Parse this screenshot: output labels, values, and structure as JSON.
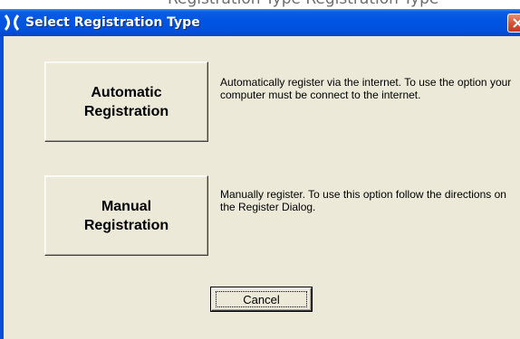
{
  "background_partial_text": "Registration Type Registration Type",
  "window": {
    "title": "Select Registration Type",
    "app_icon": "x-logo-icon",
    "close_icon": "close-icon"
  },
  "options": [
    {
      "button_line1": "Automatic",
      "button_line2": "Registration",
      "description": "Automatically register via the internet.  To use the option your computer must be connect to the internet."
    },
    {
      "button_line1": "Manual",
      "button_line2": "Registration",
      "description": "Manually register.  To use this option follow the directions on the Register Dialog."
    }
  ],
  "cancel_label": "Cancel",
  "colors": {
    "titlebar": "#0054e3",
    "client": "#ece9d8",
    "close_button": "#d6533a"
  }
}
